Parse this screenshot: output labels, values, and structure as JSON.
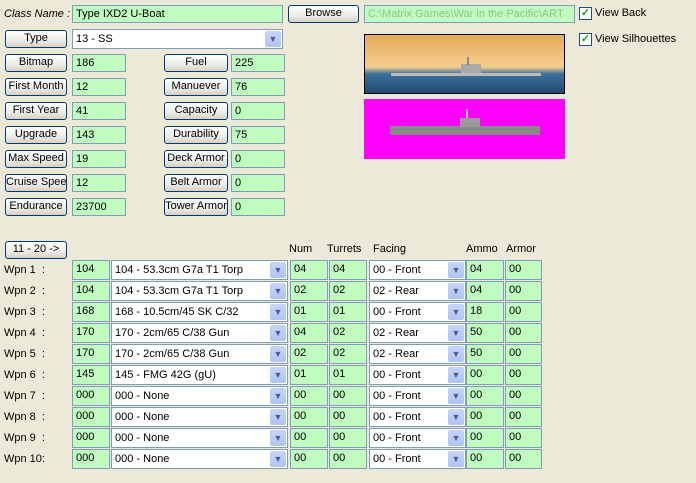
{
  "class_name": {
    "label": "Class Name :",
    "value": "Type IXD2 U-Boat"
  },
  "browse": "Browse",
  "path": "C:\\Matrix Games\\War in the Pacific\\ART",
  "view_back": {
    "label": "View Back",
    "checked": true
  },
  "view_silhouettes": {
    "label": "View Silhouettes",
    "checked": true
  },
  "type": {
    "label": "Type",
    "value": "13 -  SS"
  },
  "left_fields": [
    {
      "label": "Bitmap",
      "value": "186"
    },
    {
      "label": "First Month",
      "value": "12"
    },
    {
      "label": "First Year",
      "value": "41"
    },
    {
      "label": "Upgrade",
      "value": "143"
    },
    {
      "label": "Max Speed",
      "value": "19"
    },
    {
      "label": "Cruise Speed",
      "value": "12"
    },
    {
      "label": "Endurance",
      "value": "23700"
    }
  ],
  "right_fields": [
    {
      "label": "Fuel",
      "value": "225"
    },
    {
      "label": "Manuever",
      "value": "76"
    },
    {
      "label": "Capacity",
      "value": "0"
    },
    {
      "label": "Durability",
      "value": "75"
    },
    {
      "label": "Deck Armor",
      "value": "0"
    },
    {
      "label": "Belt Armor",
      "value": "0"
    },
    {
      "label": "Tower Armor",
      "value": "0"
    }
  ],
  "page_button": "11 - 20 ->",
  "headers": {
    "num": "Num",
    "turrets": "Turrets",
    "facing": "Facing",
    "ammo": "Ammo",
    "armor": "Armor"
  },
  "weapons": [
    {
      "label": "Wpn 1  :",
      "id": "104",
      "name": "104 - 53.3cm G7a T1 Torp",
      "num": "04",
      "turrets": "04",
      "facing": "00 - Front",
      "ammo": "04",
      "armor": "00"
    },
    {
      "label": "Wpn 2  :",
      "id": "104",
      "name": "104 - 53.3cm G7a T1 Torp",
      "num": "02",
      "turrets": "02",
      "facing": "02 - Rear",
      "ammo": "04",
      "armor": "00"
    },
    {
      "label": "Wpn 3  :",
      "id": "168",
      "name": "168 - 10.5cm/45 SK C/32",
      "num": "01",
      "turrets": "01",
      "facing": "00 - Front",
      "ammo": "18",
      "armor": "00"
    },
    {
      "label": "Wpn 4  :",
      "id": "170",
      "name": "170 - 2cm/65 C/38 Gun",
      "num": "04",
      "turrets": "02",
      "facing": "02 - Rear",
      "ammo": "50",
      "armor": "00"
    },
    {
      "label": "Wpn 5  :",
      "id": "170",
      "name": "170 - 2cm/65 C/38 Gun",
      "num": "02",
      "turrets": "02",
      "facing": "02 - Rear",
      "ammo": "50",
      "armor": "00"
    },
    {
      "label": "Wpn 6  :",
      "id": "145",
      "name": "145 - FMG 42G (gU)",
      "num": "01",
      "turrets": "01",
      "facing": "00 - Front",
      "ammo": "00",
      "armor": "00"
    },
    {
      "label": "Wpn 7  :",
      "id": "000",
      "name": "000 - None",
      "num": "00",
      "turrets": "00",
      "facing": "00 - Front",
      "ammo": "00",
      "armor": "00"
    },
    {
      "label": "Wpn 8  :",
      "id": "000",
      "name": "000 - None",
      "num": "00",
      "turrets": "00",
      "facing": "00 - Front",
      "ammo": "00",
      "armor": "00"
    },
    {
      "label": "Wpn 9  :",
      "id": "000",
      "name": "000 - None",
      "num": "00",
      "turrets": "00",
      "facing": "00 - Front",
      "ammo": "00",
      "armor": "00"
    },
    {
      "label": "Wpn 10:",
      "id": "000",
      "name": "000 - None",
      "num": "00",
      "turrets": "00",
      "facing": "00 - Front",
      "ammo": "00",
      "armor": "00"
    }
  ]
}
